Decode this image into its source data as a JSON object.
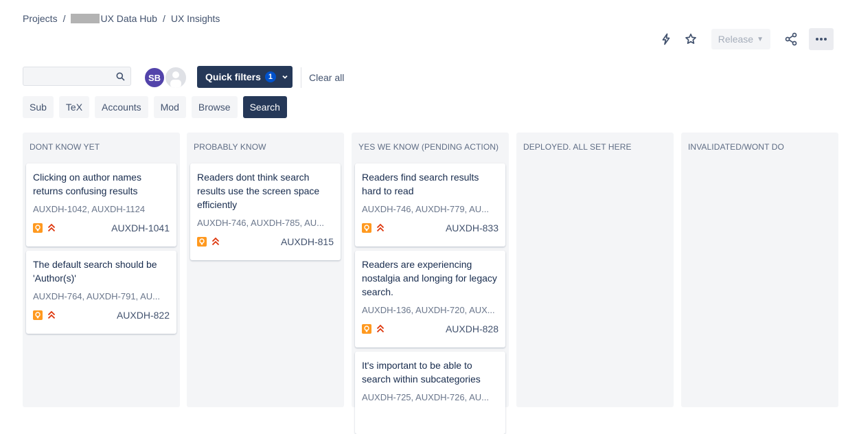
{
  "breadcrumbs": {
    "projects": "Projects",
    "separator": "/",
    "project": "UX Data Hub",
    "board": "UX Insights"
  },
  "toolbar": {
    "release_label": "Release",
    "icons": [
      "lightning-icon",
      "star-icon",
      "share-icon",
      "more-icon"
    ]
  },
  "search": {
    "value": "",
    "placeholder": ""
  },
  "avatars": [
    {
      "initials": "SB",
      "color": "#5243aa"
    },
    {
      "initials": "",
      "color": "#dfe1e6"
    }
  ],
  "filters": {
    "quick_filters_label": "Quick filters",
    "quick_filters_count": "1",
    "clear_all": "Clear all",
    "chips": [
      {
        "label": "Sub",
        "active": false
      },
      {
        "label": "TeX",
        "active": false
      },
      {
        "label": "Accounts",
        "active": false
      },
      {
        "label": "Mod",
        "active": false
      },
      {
        "label": "Browse",
        "active": false
      },
      {
        "label": "Search",
        "active": true
      }
    ]
  },
  "columns": [
    {
      "title": "DONT KNOW YET",
      "cards": [
        {
          "summary": "Clicking on author names returns confusing results",
          "linked": "AUXDH-1042, AUXDH-1124",
          "key": "AUXDH-1041"
        },
        {
          "summary": "The default search should be 'Author(s)'",
          "linked": "AUXDH-764, AUXDH-791, AU...",
          "key": "AUXDH-822"
        }
      ]
    },
    {
      "title": "PROBABLY KNOW",
      "cards": [
        {
          "summary": "Readers dont think  search results use the screen space efficiently",
          "linked": "AUXDH-746, AUXDH-785, AU...",
          "key": "AUXDH-815"
        }
      ]
    },
    {
      "title": "YES WE KNOW (PENDING ACTION)",
      "cards": [
        {
          "summary": "Readers find search results hard to read",
          "linked": "AUXDH-746, AUXDH-779, AU...",
          "key": "AUXDH-833"
        },
        {
          "summary": "Readers are experiencing nostalgia and longing for legacy search.",
          "linked": "AUXDH-136, AUXDH-720, AUX...",
          "key": "AUXDH-828"
        },
        {
          "summary": "It's important to be able to search within subcategories",
          "linked": "AUXDH-725, AUXDH-726, AU...",
          "key": ""
        }
      ]
    },
    {
      "title": "DEPLOYED. ALL SET HERE",
      "cards": []
    },
    {
      "title": "INVALIDATED/WONT DO",
      "cards": []
    }
  ],
  "colors": {
    "accent_dark": "#253858",
    "idea_icon": "#ff991f",
    "priority_icon": "#de350b",
    "column_bg": "#f4f5f7"
  }
}
